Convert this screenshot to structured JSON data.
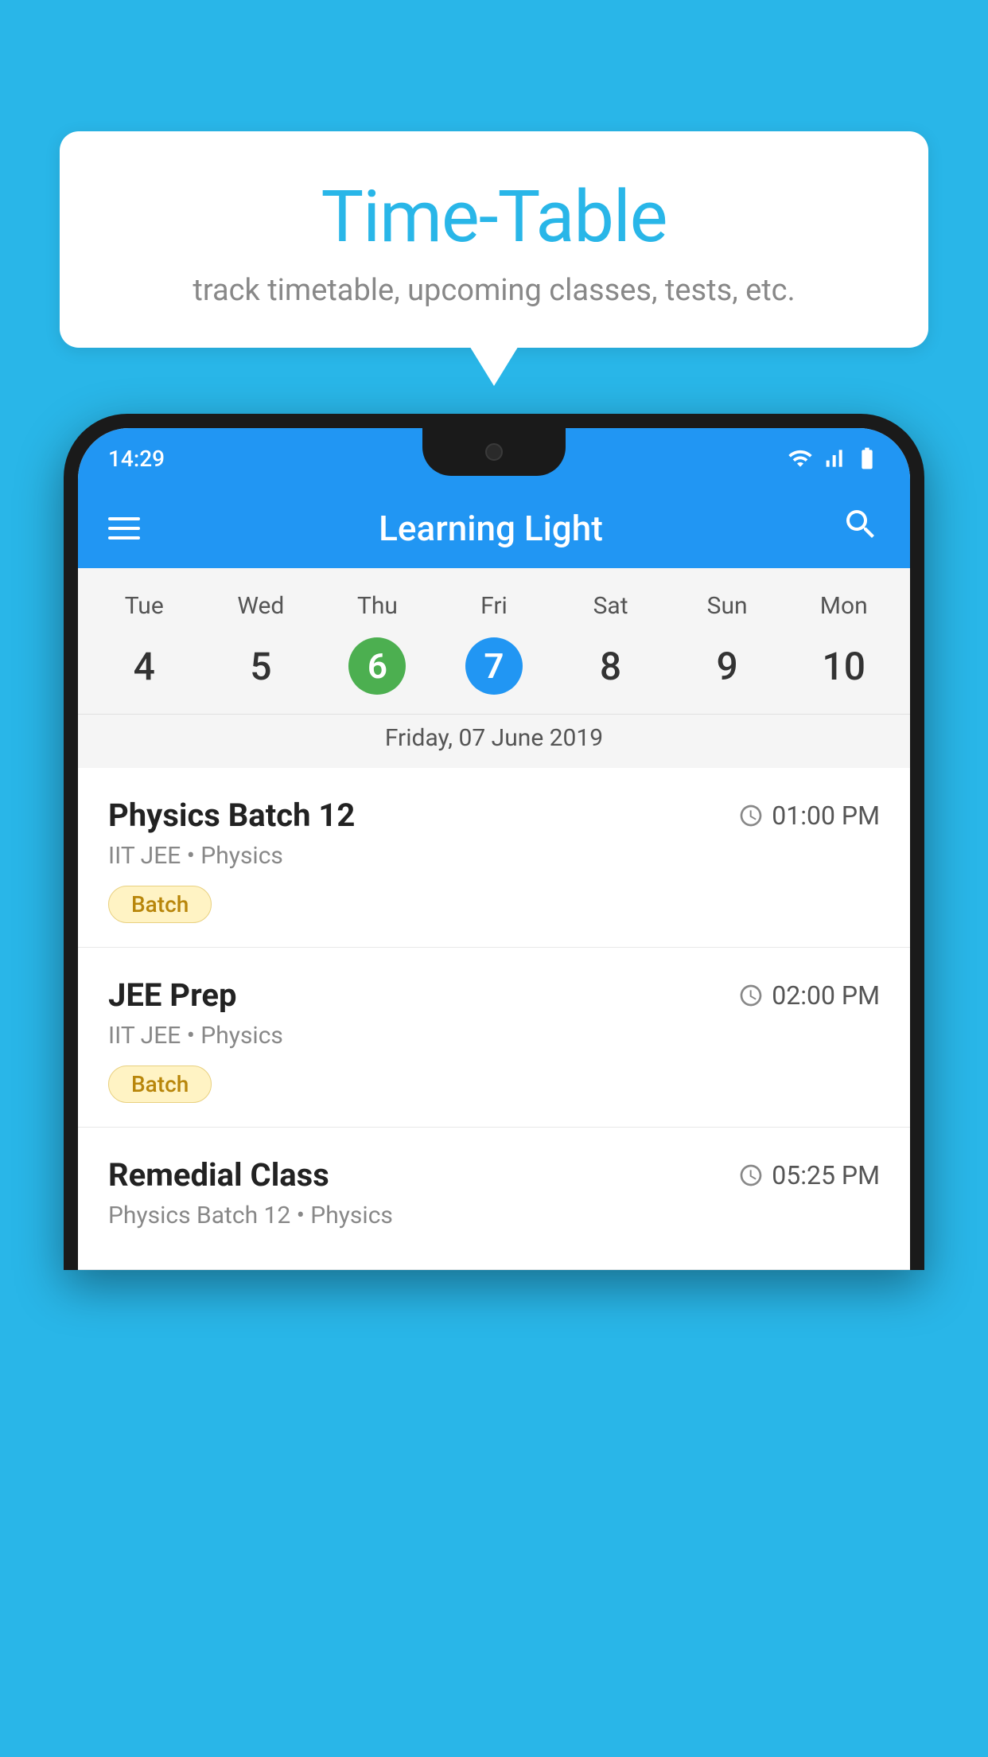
{
  "background_color": "#29b6e8",
  "speech_bubble": {
    "title": "Time-Table",
    "subtitle": "track timetable, upcoming classes, tests, etc."
  },
  "phone": {
    "status_bar": {
      "time": "14:29"
    },
    "app_bar": {
      "title": "Learning Light",
      "hamburger_label": "menu",
      "search_label": "search"
    },
    "calendar": {
      "days": [
        {
          "name": "Tue",
          "num": "4"
        },
        {
          "name": "Wed",
          "num": "5"
        },
        {
          "name": "Thu",
          "num": "6",
          "state": "today"
        },
        {
          "name": "Fri",
          "num": "7",
          "state": "selected"
        },
        {
          "name": "Sat",
          "num": "8"
        },
        {
          "name": "Sun",
          "num": "9"
        },
        {
          "name": "Mon",
          "num": "10"
        }
      ],
      "selected_date_label": "Friday, 07 June 2019"
    },
    "schedule_items": [
      {
        "title": "Physics Batch 12",
        "time": "01:00 PM",
        "subtitle": "IIT JEE • Physics",
        "badge": "Batch"
      },
      {
        "title": "JEE Prep",
        "time": "02:00 PM",
        "subtitle": "IIT JEE • Physics",
        "badge": "Batch"
      },
      {
        "title": "Remedial Class",
        "time": "05:25 PM",
        "subtitle": "Physics Batch 12 • Physics",
        "badge": null
      }
    ]
  }
}
